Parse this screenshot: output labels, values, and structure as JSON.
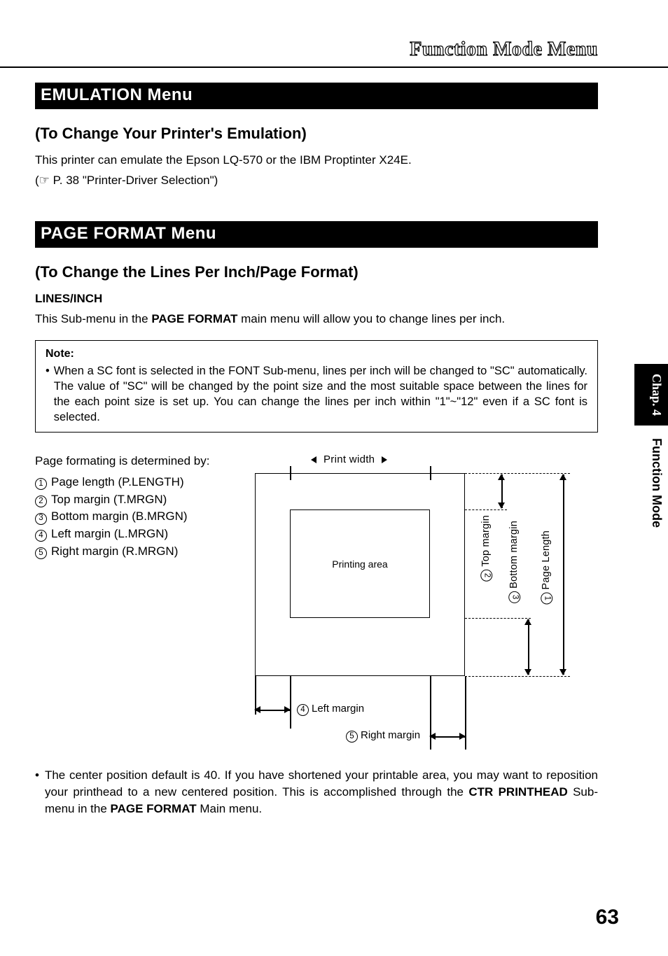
{
  "header": {
    "outline_title": "Function Mode Menu"
  },
  "section1": {
    "bar": "EMULATION Menu",
    "sub": "(To Change Your Printer's Emulation)",
    "p1": "This printer can emulate the Epson LQ-570 or the IBM Proptinter X24E.",
    "p2_prefix": "(☞  P. 38 \"Printer-Driver Selection\")"
  },
  "section2": {
    "bar": "PAGE FORMAT Menu",
    "sub": "(To Change the Lines Per Inch/Page Format)",
    "lines_title": "LINES/INCH",
    "lines_body_pre": "This Sub-menu in the ",
    "lines_body_bold": "PAGE FORMAT",
    "lines_body_post": " main menu will allow you to change lines per inch.",
    "note_title": "Note:",
    "note_body": "When a SC font is selected in the FONT Sub-menu, lines per inch will be changed to \"SC\" automatically. The value of \"SC\" will be changed by the point size and the most suitable space between the lines for the each point size is set up. You can change the lines per inch within \"1\"~\"12\" even if a SC font is selected.",
    "det_intro": "Page formating is determined by:",
    "items": [
      "Page length (P.LENGTH)",
      "Top margin (T.MRGN)",
      "Bottom margin (B.MRGN)",
      "Left margin (L.MRGN)",
      "Right margin (R.MRGN)"
    ],
    "diagram": {
      "print_width": "Print width",
      "printing_area": "Printing area",
      "top_margin": "Top margin",
      "bottom_margin": "Bottom margin",
      "page_length": "Page Length",
      "left_margin": "Left margin",
      "right_margin": "Right margin"
    },
    "footer_para_pre": "The center position default is 40. If you have shortened your printable area, you may want to reposition your printhead to a new centered position. This is accomplished through the ",
    "footer_bold1": "CTR PRINTHEAD",
    "footer_mid": " Sub-menu in the ",
    "footer_bold2": "PAGE FORMAT",
    "footer_end": " Main menu."
  },
  "tabs": {
    "chap": "Chap. 4",
    "mode": "Function Mode"
  },
  "page_number": "63"
}
